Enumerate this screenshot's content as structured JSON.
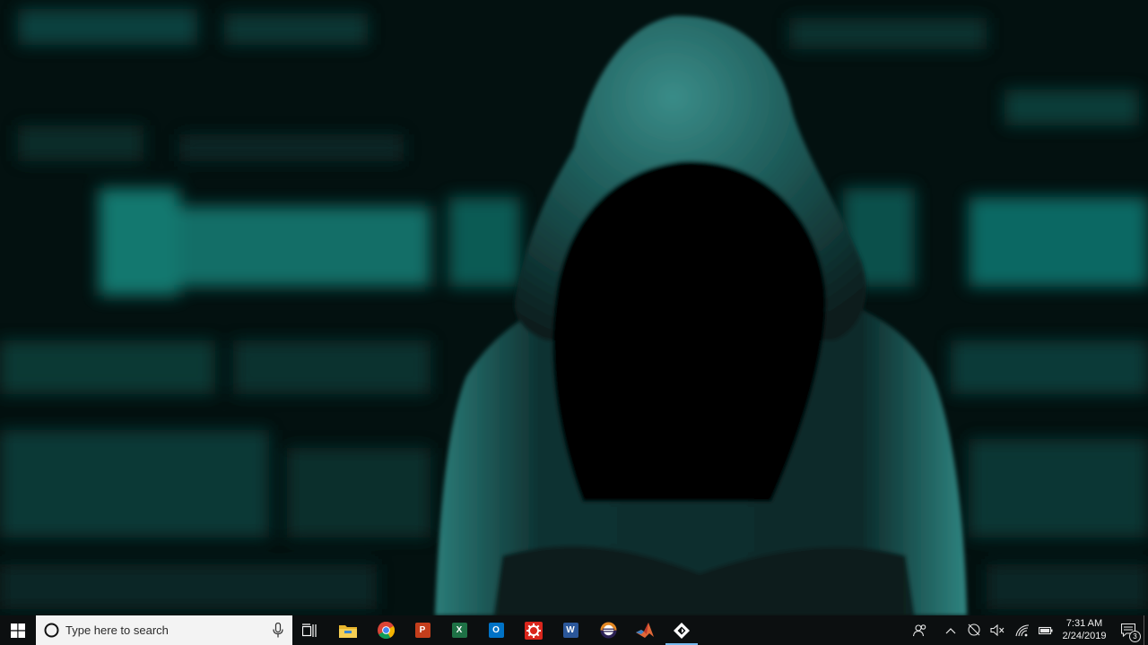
{
  "wallpaper": {
    "description_icon": "hooded-figure-wallpaper",
    "accent": "#1f9e93"
  },
  "taskbar": {
    "background": "#0c0f10",
    "search_placeholder": "Type here to search",
    "apps": [
      {
        "name": "task-view",
        "icon": "task-view-icon"
      },
      {
        "name": "file-explorer",
        "icon": "folder-icon"
      },
      {
        "name": "chrome",
        "icon": "chrome-icon"
      },
      {
        "name": "powerpoint",
        "icon": "powerpoint-icon",
        "letter": "P"
      },
      {
        "name": "excel",
        "icon": "excel-icon",
        "letter": "X"
      },
      {
        "name": "outlook",
        "icon": "outlook-icon",
        "letter": "O"
      },
      {
        "name": "settings-gear",
        "icon": "red-gear-icon"
      },
      {
        "name": "word",
        "icon": "word-icon",
        "letter": "W"
      },
      {
        "name": "eclipse",
        "icon": "eclipse-icon"
      },
      {
        "name": "matlab",
        "icon": "matlab-icon"
      },
      {
        "name": "active-app",
        "icon": "diamond-app-icon",
        "active": true
      }
    ],
    "tray": {
      "time": "7:31 AM",
      "date": "2/24/2019",
      "notification_count": "3"
    }
  }
}
